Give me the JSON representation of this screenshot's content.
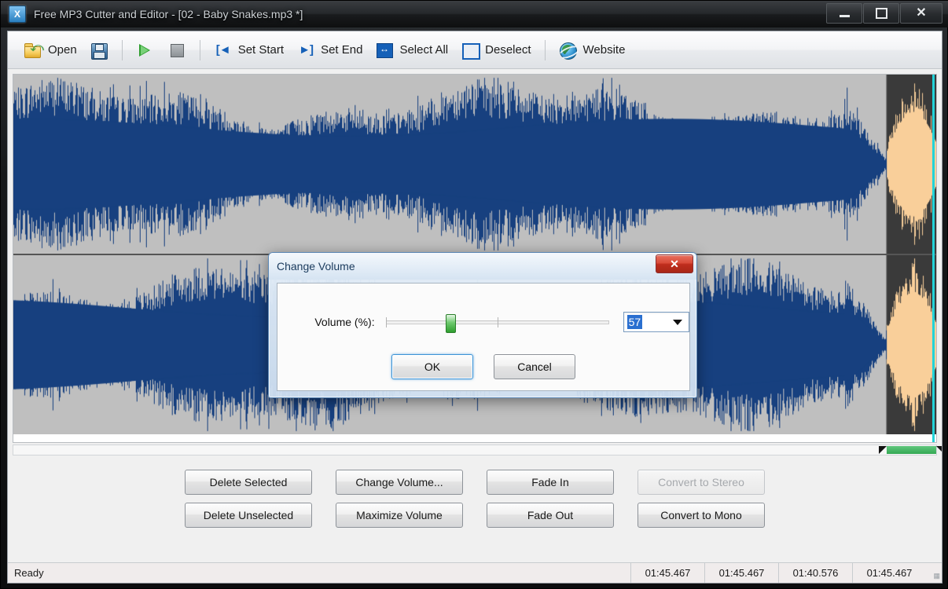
{
  "window": {
    "title": "Free MP3 Cutter and Editor - [02 - Baby Snakes.mp3 *]",
    "app_icon": "mp3-app-icon",
    "minimize_label": "–",
    "maximize_label": "□",
    "close_label": "×"
  },
  "toolbar": {
    "items": [
      {
        "label": "Open",
        "icon": "open-folder-icon"
      },
      {
        "label": "",
        "icon": "save-floppy-icon"
      },
      {
        "label": "",
        "icon": "play-icon"
      },
      {
        "label": "",
        "icon": "stop-icon"
      },
      {
        "label": "Set Start",
        "icon": "set-start-icon"
      },
      {
        "label": "Set End",
        "icon": "set-end-icon"
      },
      {
        "label": "Select All",
        "icon": "select-all-icon"
      },
      {
        "label": "Deselect",
        "icon": "deselect-icon"
      },
      {
        "label": "Website",
        "icon": "globe-icon"
      }
    ]
  },
  "waveform": {
    "channels": 2,
    "wave_color": "#17407f",
    "background_color": "#bfbfbf",
    "selection_background": "#3a3a3a",
    "selection_wave_color": "#f9cf9a",
    "cursor_color": "#22d3d8",
    "selection_start_pct": 94.6,
    "selection_end_pct": 100
  },
  "selection_strip": {
    "green_color": "#34a853",
    "start_pct": 94.6,
    "end_pct": 100
  },
  "actions": {
    "row1": [
      {
        "label": "Delete Selected",
        "enabled": true
      },
      {
        "label": "Change Volume...",
        "enabled": true
      },
      {
        "label": "Fade In",
        "enabled": true
      },
      {
        "label": "Convert to Stereo",
        "enabled": false
      }
    ],
    "row2": [
      {
        "label": "Delete Unselected",
        "enabled": true
      },
      {
        "label": "Maximize Volume",
        "enabled": true
      },
      {
        "label": "Fade Out",
        "enabled": true
      },
      {
        "label": "Convert to Mono",
        "enabled": true
      }
    ]
  },
  "statusbar": {
    "message": "Ready",
    "cells": [
      "01:45.467",
      "01:45.467",
      "01:40.576",
      "01:45.467"
    ],
    "grip": "///"
  },
  "dialog": {
    "title": "Change Volume",
    "close_label": "✕",
    "volume_label": "Volume (%):",
    "volume_value": "57",
    "slider_min": 0,
    "slider_max": 200,
    "slider_position_pct": 28.5,
    "slider_tick_pct": 50,
    "ok_label": "OK",
    "cancel_label": "Cancel"
  }
}
